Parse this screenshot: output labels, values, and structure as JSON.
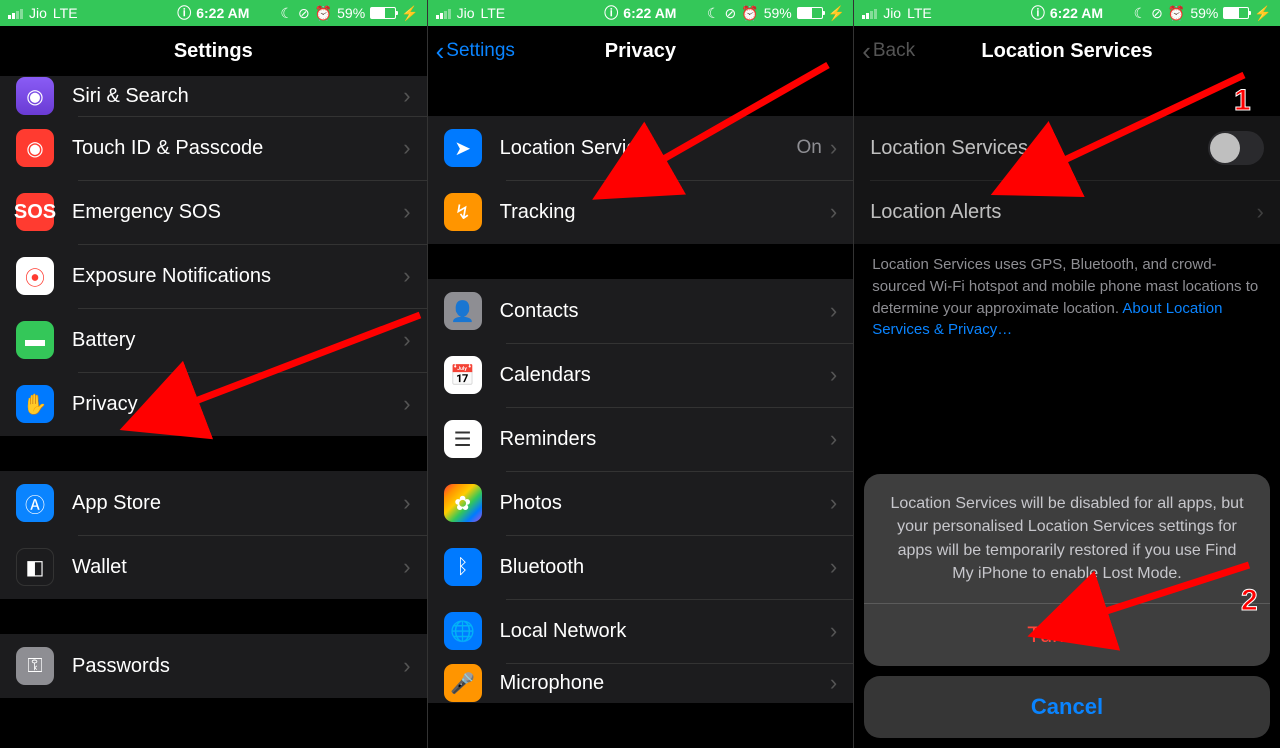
{
  "status": {
    "carrier": "Jio",
    "net": "LTE",
    "time": "6:22 AM",
    "battery": "59%"
  },
  "screen1": {
    "title": "Settings",
    "rows": {
      "siri": "Siri & Search",
      "touchid": "Touch ID & Passcode",
      "sos": "Emergency SOS",
      "exposure": "Exposure Notifications",
      "battery": "Battery",
      "privacy": "Privacy",
      "appstore": "App Store",
      "wallet": "Wallet",
      "passwords": "Passwords"
    }
  },
  "screen2": {
    "back": "Settings",
    "title": "Privacy",
    "rows": {
      "location": "Location Services",
      "location_value": "On",
      "tracking": "Tracking",
      "contacts": "Contacts",
      "calendars": "Calendars",
      "reminders": "Reminders",
      "photos": "Photos",
      "bluetooth": "Bluetooth",
      "local": "Local Network",
      "mic": "Microphone"
    }
  },
  "screen3": {
    "back": "Back",
    "title": "Location Services",
    "rows": {
      "location": "Location Services",
      "alerts": "Location Alerts"
    },
    "footnote_text": "Location Services uses GPS, Bluetooth, and crowd-sourced Wi-Fi hotspot and mobile phone mast locations to determine your approximate location. ",
    "footnote_link": "About Location Services & Privacy…",
    "sheet_msg": "Location Services will be disabled for all apps, but your personalised Location Services settings for apps will be temporarily restored if you use Find My iPhone to enable Lost Mode.",
    "sheet_action": "Turn Off",
    "sheet_cancel": "Cancel",
    "badge1": "1",
    "badge2": "2"
  }
}
